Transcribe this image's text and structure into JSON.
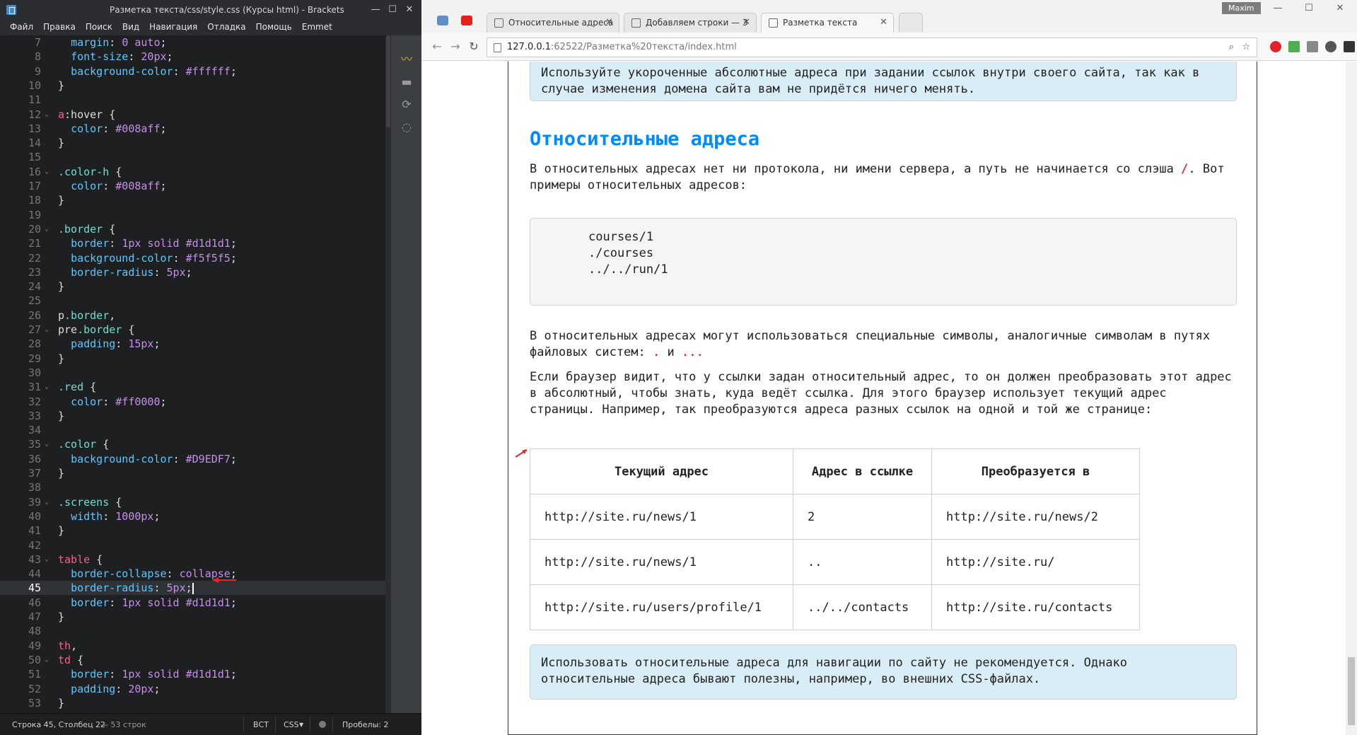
{
  "brackets": {
    "title": "Разметка текста/css/style.css (Курсы html) - Brackets",
    "menu": [
      "Файл",
      "Правка",
      "Поиск",
      "Вид",
      "Навигация",
      "Отладка",
      "Помощь",
      "Emmet"
    ],
    "window_controls": [
      "—",
      "☐",
      "✕"
    ],
    "lines": [
      {
        "n": "7",
        "t": "  margin: 0 auto;"
      },
      {
        "n": "8",
        "t": "  font-size: 20px;"
      },
      {
        "n": "9",
        "t": "  background-color: #ffffff;"
      },
      {
        "n": "10",
        "t": "}"
      },
      {
        "n": "11",
        "t": ""
      },
      {
        "n": "12",
        "t": "a:hover {"
      },
      {
        "n": "13",
        "t": "  color: #008aff;"
      },
      {
        "n": "14",
        "t": "}"
      },
      {
        "n": "15",
        "t": ""
      },
      {
        "n": "16",
        "t": ".color-h {"
      },
      {
        "n": "17",
        "t": "  color: #008aff;"
      },
      {
        "n": "18",
        "t": "}"
      },
      {
        "n": "19",
        "t": ""
      },
      {
        "n": "20",
        "t": ".border {"
      },
      {
        "n": "21",
        "t": "  border: 1px solid #d1d1d1;"
      },
      {
        "n": "22",
        "t": "  background-color: #f5f5f5;"
      },
      {
        "n": "23",
        "t": "  border-radius: 5px;"
      },
      {
        "n": "24",
        "t": "}"
      },
      {
        "n": "25",
        "t": ""
      },
      {
        "n": "26",
        "t": "p.border,"
      },
      {
        "n": "27",
        "t": "pre.border {"
      },
      {
        "n": "28",
        "t": "  padding: 15px;"
      },
      {
        "n": "29",
        "t": "}"
      },
      {
        "n": "30",
        "t": ""
      },
      {
        "n": "31",
        "t": ".red {"
      },
      {
        "n": "32",
        "t": "  color: #ff0000;"
      },
      {
        "n": "33",
        "t": "}"
      },
      {
        "n": "34",
        "t": ""
      },
      {
        "n": "35",
        "t": ".color {"
      },
      {
        "n": "36",
        "t": "  background-color: #D9EDF7;"
      },
      {
        "n": "37",
        "t": "}"
      },
      {
        "n": "38",
        "t": ""
      },
      {
        "n": "39",
        "t": ".screens {"
      },
      {
        "n": "40",
        "t": "  width: 1000px;"
      },
      {
        "n": "41",
        "t": "}"
      },
      {
        "n": "42",
        "t": ""
      },
      {
        "n": "43",
        "t": "table {"
      },
      {
        "n": "44",
        "t": "  border-collapse: collapse;"
      },
      {
        "n": "45",
        "t": "  border-radius: 5px;"
      },
      {
        "n": "46",
        "t": "  border: 1px solid #d1d1d1;"
      },
      {
        "n": "47",
        "t": "}"
      },
      {
        "n": "48",
        "t": ""
      },
      {
        "n": "49",
        "t": "th,"
      },
      {
        "n": "50",
        "t": "td {"
      },
      {
        "n": "51",
        "t": "  border: 1px solid #d1d1d1;"
      },
      {
        "n": "52",
        "t": "  padding: 20px;"
      },
      {
        "n": "53",
        "t": "}"
      }
    ],
    "active_line": "45",
    "fold_lines": [
      "12",
      "16",
      "20",
      "27",
      "31",
      "35",
      "39",
      "43",
      "50"
    ],
    "status": {
      "position": "Строка 45, Столбец 22",
      "line_count": "— 53 строк",
      "mode": "ВСТ",
      "language": "CSS",
      "spaces": "Пробелы: 2"
    },
    "colors": {
      "selector": "#ff5c8a",
      "class": "#6fdfd0",
      "property": "#5bc8ff",
      "value": "#c58fe8"
    }
  },
  "chrome": {
    "user": "Maxim",
    "tabs": [
      {
        "label": "Относительные адреса",
        "active": false
      },
      {
        "label": "Добавляем строки — 3",
        "active": false
      },
      {
        "label": "Разметка текста",
        "active": true
      }
    ],
    "tab_close": "✕",
    "url_host": "127.0.0.1",
    "url_path": ":62522/Разметка%20текста/index.html",
    "window_controls": [
      "—",
      "☐",
      "✕"
    ]
  },
  "page": {
    "note_top": "Используйте укороченные абсолютные адреса при задании ссылок внутри своего сайта, так как в случае изменения домена сайта вам не придётся ничего менять.",
    "heading": "Относительные адреса",
    "para1_a": "В относительных адресах нет ни протокола, ни имени сервера, а путь не начинается со слэша",
    "para1_slash": "/",
    "para1_b": ". Вот примеры относительных адресов:",
    "pre_lines": [
      "courses/1",
      "./courses",
      "../../run/1"
    ],
    "para2_a": "В относительных адресах могут использоваться специальные символы, аналогичные символам в путях файловых систем:",
    "para2_dot": ".",
    "para2_and": "и",
    "para2_dots": "...",
    "para3": "Если браузер видит, что у ссылки задан относительный адрес, то он должен преобразовать этот адрес в абсолютный, чтобы знать, куда ведёт ссылка. Для этого браузер использует текущий адрес страницы. Например, так преобразуются адреса разных ссылок на одной и той же странице:",
    "table": {
      "headers": [
        "Текущий адрес",
        "Адрес в ссылке",
        "Преобразуется в"
      ],
      "rows": [
        [
          "http://site.ru/news/1",
          "2",
          "http://site.ru/news/2"
        ],
        [
          "http://site.ru/news/1",
          "..",
          "http://site.ru/"
        ],
        [
          "http://site.ru/users/profile/1",
          "../../contacts",
          "http://site.ru/contacts"
        ]
      ]
    },
    "note_bottom": "Использовать относительные адреса для навигации по сайту не рекомендуется. Однако относительные адреса бывают полезны, например, во внешних CSS-файлах."
  }
}
